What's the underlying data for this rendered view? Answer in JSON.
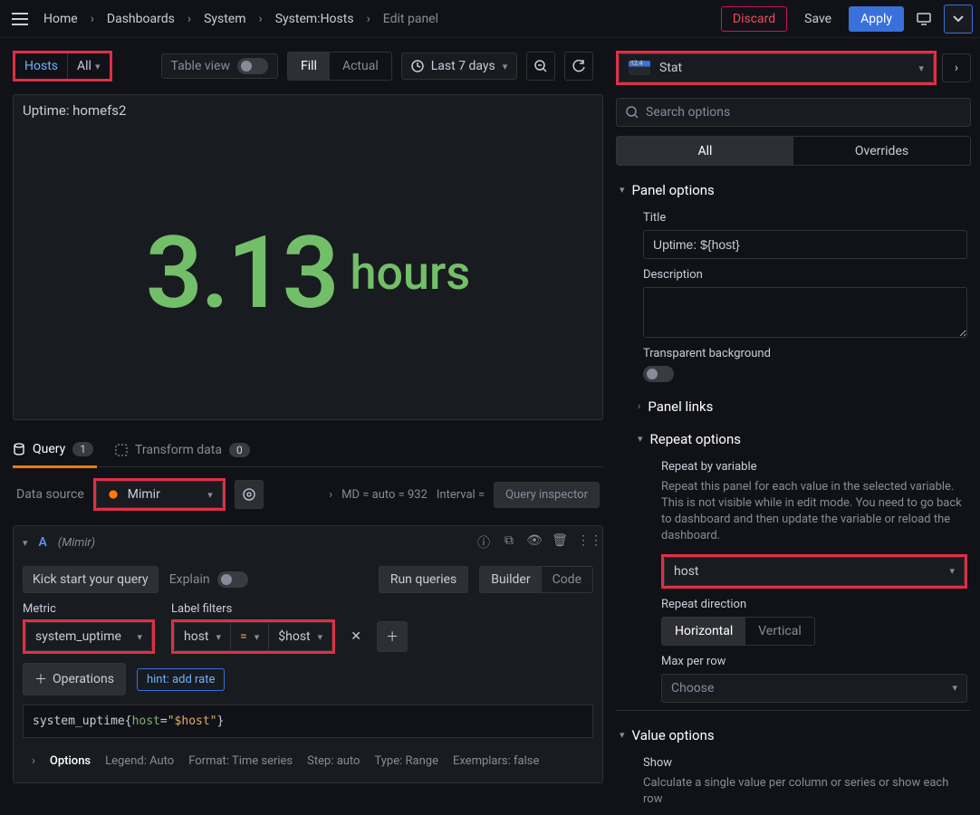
{
  "breadcrumbs": [
    "Home",
    "Dashboards",
    "System",
    "System:Hosts",
    "Edit panel"
  ],
  "top_buttons": {
    "discard": "Discard",
    "save": "Save",
    "apply": "Apply"
  },
  "vars": {
    "hosts_label": "Hosts",
    "hosts_value": "All"
  },
  "toolbar": {
    "table_view": "Table view",
    "fill": "Fill",
    "actual": "Actual",
    "time_range": "Last 7 days"
  },
  "panel": {
    "title": "Uptime: homefs2",
    "value": "3.13",
    "unit": "hours"
  },
  "editor_tabs": {
    "query": "Query",
    "query_count": "1",
    "transform": "Transform data",
    "transform_count": "0"
  },
  "datasource": {
    "label": "Data source",
    "name": "Mimir",
    "md": "MD = auto = 932",
    "interval": "Interval =",
    "inspector": "Query inspector"
  },
  "query": {
    "id": "A",
    "src": "(Mimir)",
    "kick": "Kick start your query",
    "explain": "Explain",
    "run": "Run queries",
    "builder": "Builder",
    "code": "Code",
    "metric_label": "Metric",
    "metric_value": "system_uptime",
    "filters_label": "Label filters",
    "filter_key": "host",
    "filter_op": "=",
    "filter_val": "$host",
    "ops": "Operations",
    "hint": "hint: add rate",
    "expr_metric": "system_uptime",
    "expr_key": "host",
    "expr_val": "\"$host\"",
    "options": "Options",
    "legend": "Legend: Auto",
    "format": "Format: Time series",
    "step": "Step: auto",
    "type": "Type: Range",
    "exemplars": "Exemplars: false"
  },
  "viz": {
    "type": "Stat",
    "search_placeholder": "Search options"
  },
  "tabs": {
    "all": "All",
    "overrides": "Overrides"
  },
  "sections": {
    "panel_options": "Panel options",
    "title_label": "Title",
    "title_value": "Uptime: ${host}",
    "desc_label": "Description",
    "transparent": "Transparent background",
    "panel_links": "Panel links",
    "repeat": "Repeat options",
    "repeat_by": "Repeat by variable",
    "repeat_help": "Repeat this panel for each value in the selected variable. This is not visible while in edit mode. You need to go back to dashboard and then update the variable or reload the dashboard.",
    "repeat_value": "host",
    "direction_label": "Repeat direction",
    "horizontal": "Horizontal",
    "vertical": "Vertical",
    "max_label": "Max per row",
    "max_value": "Choose",
    "value_options": "Value options",
    "show_label": "Show",
    "show_help": "Calculate a single value per column or series or show each row"
  }
}
